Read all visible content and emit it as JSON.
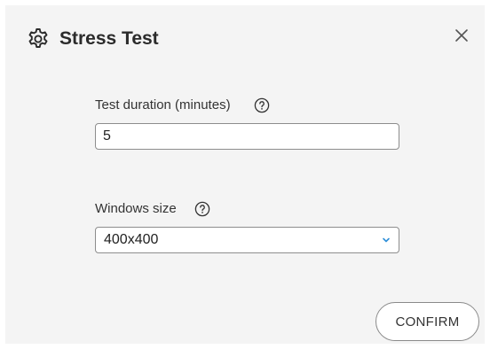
{
  "dialog": {
    "title": "Stress Test",
    "title_icon": "gear-icon",
    "close_icon": "close-icon"
  },
  "fields": {
    "duration": {
      "label": "Test duration (minutes)",
      "help_icon": "help-circle-icon",
      "value": "5"
    },
    "window_size": {
      "label": "Windows size",
      "help_icon": "help-circle-icon",
      "selected": "400x400",
      "dropdown_icon": "chevron-down-icon"
    }
  },
  "actions": {
    "confirm_label": "CONFIRM"
  },
  "colors": {
    "dialog_background": "#f4f4f4",
    "chevron_accent": "#2f8fd8",
    "border": "#8d8d8d"
  }
}
